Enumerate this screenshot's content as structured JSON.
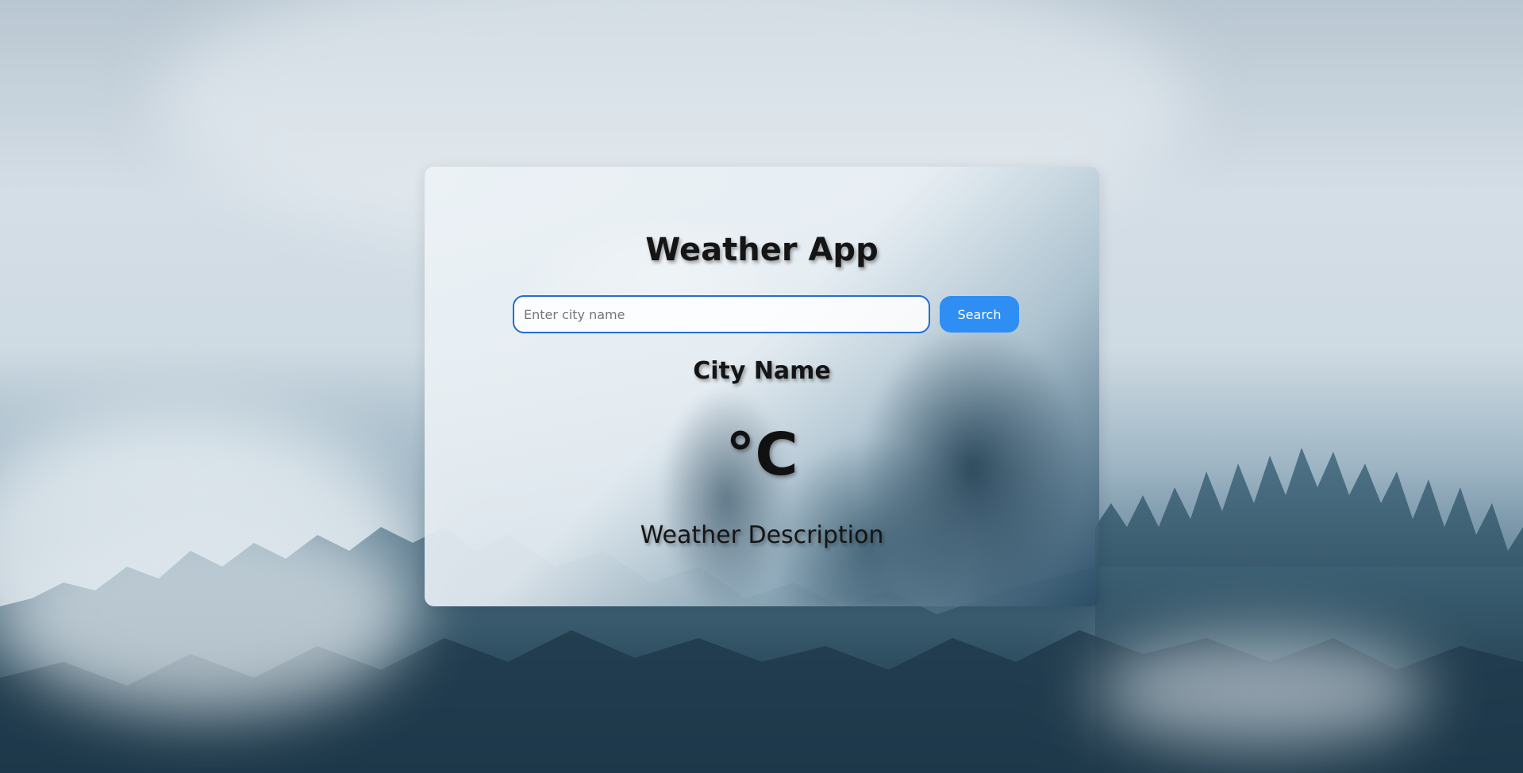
{
  "app": {
    "title": "Weather App"
  },
  "search": {
    "placeholder": "Enter city name",
    "value": "",
    "button_label": "Search"
  },
  "weather": {
    "city": "City Name",
    "temperature": "°C",
    "description": "Weather Description"
  },
  "colors": {
    "accent": "#2f8ef4",
    "input_border": "#1f6fd0",
    "text": "#151515"
  }
}
